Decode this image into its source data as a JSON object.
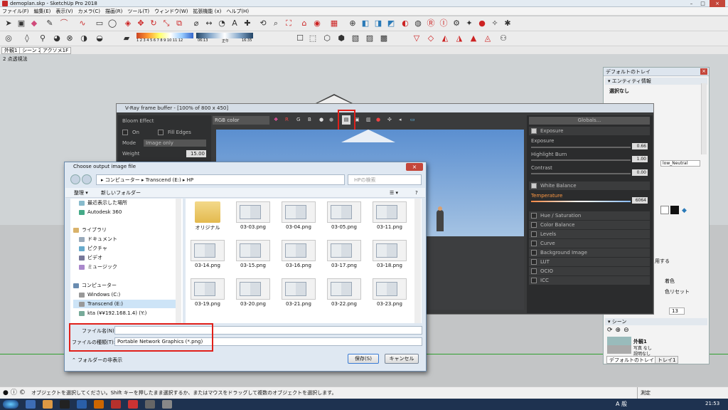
{
  "window": {
    "title": "demoplan.skp - SketchUp Pro 2018"
  },
  "menu": [
    "ファイル(F)",
    "編集(E)",
    "表示(V)",
    "カメラ(C)",
    "描画(R)",
    "ツール(T)",
    "ウィンドウ(W)",
    "拡張機能 (x)",
    "ヘルプ(H)"
  ],
  "shadow_bar": {
    "hours": "1 2 3 4 5 6 7 8 9 10 11 12",
    "time_start": "06:13",
    "time_mid": "正午",
    "time_end": "16:35"
  },
  "scene_tabs": [
    "外観1",
    "シーン 2",
    "アクソメ1F"
  ],
  "viewport": {
    "label": "2 点透視法"
  },
  "tray": {
    "title": "デフォルトのトレイ",
    "entity_header": "エンティティ情報",
    "selection": "選択なし",
    "style_name": "low_Neutral",
    "edge_label": "用する",
    "color_label": "着色",
    "color_reset": "色リセット",
    "spin_value": "13",
    "scenes_header": "シーン",
    "scene_name": "外観1",
    "scene_sub1": "写真 なし",
    "scene_sub2": "説明なし",
    "tabs": [
      "デフォルトのトレイ",
      "トレイ1"
    ]
  },
  "vfb": {
    "title": "V-Ray frame buffer - [100% of 800 x 450]",
    "channel": "RGB color",
    "rgb": [
      "R",
      "G",
      "B"
    ],
    "bloom": {
      "title": "Bloom Effect",
      "on": "On",
      "fill_edges": "Fill Edges",
      "mode_label": "Mode",
      "mode_value": "Image only",
      "weight_label": "Weight",
      "weight_value": "15.00"
    },
    "globals": "Globals...",
    "exposure": {
      "label": "Exposure",
      "exposure": "Exposure",
      "exposure_val": "0.66",
      "highlight": "Highlight Burn",
      "highlight_val": "1.00",
      "contrast": "Contrast",
      "contrast_val": "0.00"
    },
    "white_balance": {
      "label": "White Balance",
      "temperature": "Temperature",
      "temp_val": "6064"
    },
    "layers": [
      "Hue / Saturation",
      "Color Balance",
      "Levels",
      "Curve",
      "Background Image",
      "LUT",
      "OCIO",
      "ICC"
    ]
  },
  "dialog": {
    "title": "Choose output image file",
    "breadcrumb": "▸ コンピューター ▸ Transcend (E:) ▸ HP",
    "search_placeholder": "HPの検索",
    "organize": "整理 ▾",
    "new_folder": "新しいフォルダー",
    "nav": [
      "最近表示した場所",
      "Autodesk 360",
      "ライブラリ",
      "ドキュメント",
      "ピクチャ",
      "ビデオ",
      "ミュージック",
      "コンピューター",
      "Windows (C:)",
      "Transcend (E:)",
      "kta (¥¥192.168.1.4) (Y:)"
    ],
    "files": [
      "オリジナル",
      "03-03.png",
      "03-04.png",
      "03-05.png",
      "03-11.png",
      "03-14.png",
      "03-15.png",
      "03-16.png",
      "03-17.png",
      "03-18.png",
      "03-19.png",
      "03-20.png",
      "03-21.png",
      "03-22.png",
      "03-23.png"
    ],
    "filename_label": "ファイル名(N):",
    "filename_value": "",
    "filetype_label": "ファイルの種類(T):",
    "filetype_value": "Portable Network Graphics (*.png)",
    "hide_folders": "フォルダーの非表示",
    "save": "保存(S)",
    "cancel": "キャンセル"
  },
  "status": {
    "text": "オブジェクトを選択してください。Shift キーを押したまま選択するか、またはマウスをドラッグして複数のオブジェクトを選択します。",
    "measure_label": "測定"
  },
  "taskbar": {
    "clock": "21:53",
    "ime": "A 般"
  }
}
